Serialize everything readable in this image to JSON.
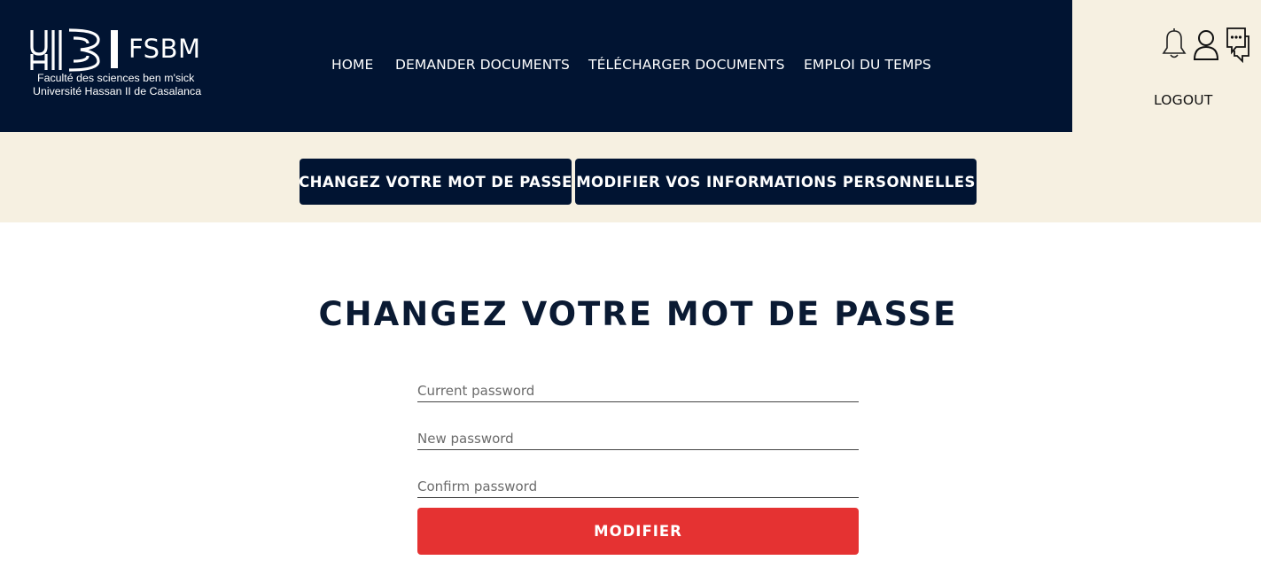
{
  "brand": {
    "acronym": "FSBM",
    "line1": "Faculté des sciences ben m'sick",
    "line2": "Université Hassan II de Casalanca"
  },
  "nav": {
    "items": [
      {
        "label": "HOME"
      },
      {
        "label": "DEMANDER DOCUMENTS"
      },
      {
        "label": "TÉLÉCHARGER DOCUMENTS"
      },
      {
        "label": "EMPLOI DU TEMPS"
      }
    ],
    "logout_label": "LOGOUT",
    "icons": [
      "bell-icon",
      "user-icon",
      "chat-icon"
    ]
  },
  "tabs": [
    {
      "label": "CHANGEZ VOTRE MOT DE PASSE"
    },
    {
      "label": "MODIFIER VOS INFORMATIONS PERSONNELLES"
    }
  ],
  "form": {
    "title": "CHANGEZ VOTRE MOT DE PASSE",
    "current_placeholder": "Current password",
    "new_placeholder": "New password",
    "confirm_placeholder": "Confirm password",
    "current_value": "",
    "new_value": "",
    "confirm_value": "",
    "submit_label": "MODIFIER"
  },
  "colors": {
    "navy": "#011432",
    "cream": "#f6f0e1",
    "accent_red": "#e53232"
  }
}
